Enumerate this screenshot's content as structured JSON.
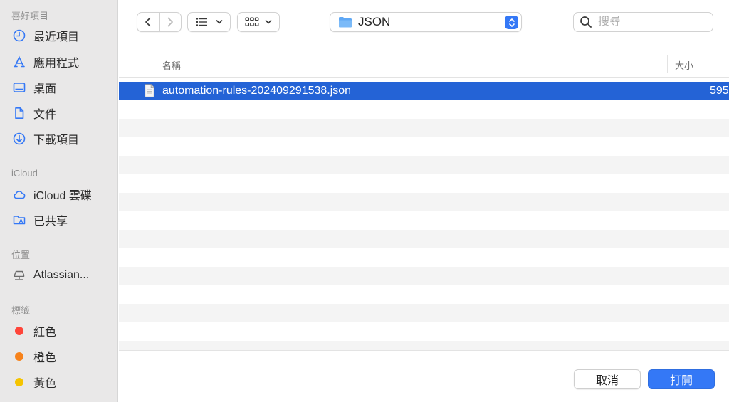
{
  "sidebar": {
    "favorites_title": "喜好項目",
    "favorites": [
      {
        "label": "最近項目",
        "icon": "clock-icon"
      },
      {
        "label": "應用程式",
        "icon": "applications-icon"
      },
      {
        "label": "桌面",
        "icon": "desktop-icon"
      },
      {
        "label": "文件",
        "icon": "document-icon"
      },
      {
        "label": "下載項目",
        "icon": "download-icon"
      }
    ],
    "icloud_title": "iCloud",
    "icloud": [
      {
        "label": "iCloud 雲碟",
        "icon": "cloud-icon"
      },
      {
        "label": "已共享",
        "icon": "shared-folder-icon"
      }
    ],
    "locations_title": "位置",
    "locations": [
      {
        "label": "Atlassian...",
        "icon": "network-drive-icon"
      }
    ],
    "tags_title": "標籤",
    "tags": [
      {
        "label": "紅色",
        "color": "#ff453a"
      },
      {
        "label": "橙色",
        "color": "#f7821b"
      },
      {
        "label": "黃色",
        "color": "#f5c400"
      }
    ]
  },
  "toolbar": {
    "current_folder": "JSON",
    "search_placeholder": "搜尋",
    "accent_color": "#3478f6"
  },
  "columns": {
    "name": "名稱",
    "size": "大小"
  },
  "files": [
    {
      "name": "automation-rules-202409291538.json",
      "size": "595",
      "selected": true
    }
  ],
  "buttons": {
    "cancel": "取消",
    "open": "打開"
  }
}
